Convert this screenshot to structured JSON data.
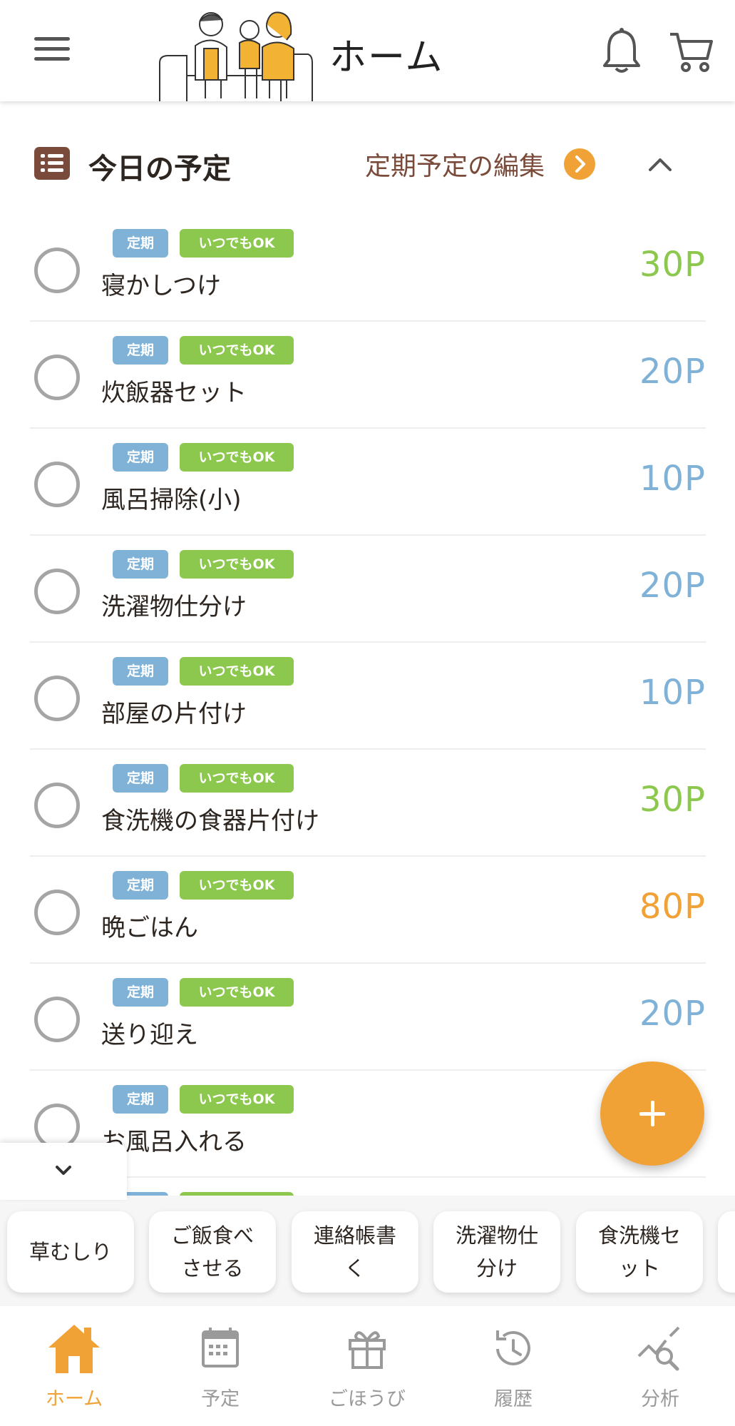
{
  "header": {
    "title": "ホーム"
  },
  "section": {
    "title": "今日の予定",
    "edit_label": "定期予定の編集"
  },
  "tasks": [
    {
      "tag1": "定期",
      "tag2": "いつでもOK",
      "name": "寝かしつけ",
      "points": "30P",
      "points_color": "#8dc84e"
    },
    {
      "tag1": "定期",
      "tag2": "いつでもOK",
      "name": "炊飯器セット",
      "points": "20P",
      "points_color": "#7fb2d6"
    },
    {
      "tag1": "定期",
      "tag2": "いつでもOK",
      "name": "風呂掃除(小)",
      "points": "10P",
      "points_color": "#7fb2d6"
    },
    {
      "tag1": "定期",
      "tag2": "いつでもOK",
      "name": "洗濯物仕分け",
      "points": "20P",
      "points_color": "#7fb2d6"
    },
    {
      "tag1": "定期",
      "tag2": "いつでもOK",
      "name": "部屋の片付け",
      "points": "10P",
      "points_color": "#7fb2d6"
    },
    {
      "tag1": "定期",
      "tag2": "いつでもOK",
      "name": "食洗機の食器片付け",
      "points": "30P",
      "points_color": "#8dc84e"
    },
    {
      "tag1": "定期",
      "tag2": "いつでもOK",
      "name": "晩ごはん",
      "points": "80P",
      "points_color": "#f0a236"
    },
    {
      "tag1": "定期",
      "tag2": "いつでもOK",
      "name": "送り迎え",
      "points": "20P",
      "points_color": "#7fb2d6"
    },
    {
      "tag1": "定期",
      "tag2": "いつでもOK",
      "name": "お風呂入れる",
      "points": "",
      "points_color": "#7fb2d6"
    }
  ],
  "quick_tray": {
    "items": [
      "草むしり",
      "ご飯食べさせる",
      "連絡帳書く",
      "洗濯物仕分け",
      "食洗機セット"
    ]
  },
  "bottom_nav": {
    "items": [
      {
        "label": "ホーム",
        "icon": "home-icon",
        "active": true
      },
      {
        "label": "予定",
        "icon": "calendar-icon",
        "active": false
      },
      {
        "label": "ごほうび",
        "icon": "gift-icon",
        "active": false
      },
      {
        "label": "履歴",
        "icon": "history-icon",
        "active": false
      },
      {
        "label": "分析",
        "icon": "analysis-icon",
        "active": false
      }
    ]
  },
  "colors": {
    "accent": "#f0a236",
    "brown": "#7a4b3a",
    "tag_blue": "#7fb2d6",
    "tag_green": "#8dc84e"
  }
}
